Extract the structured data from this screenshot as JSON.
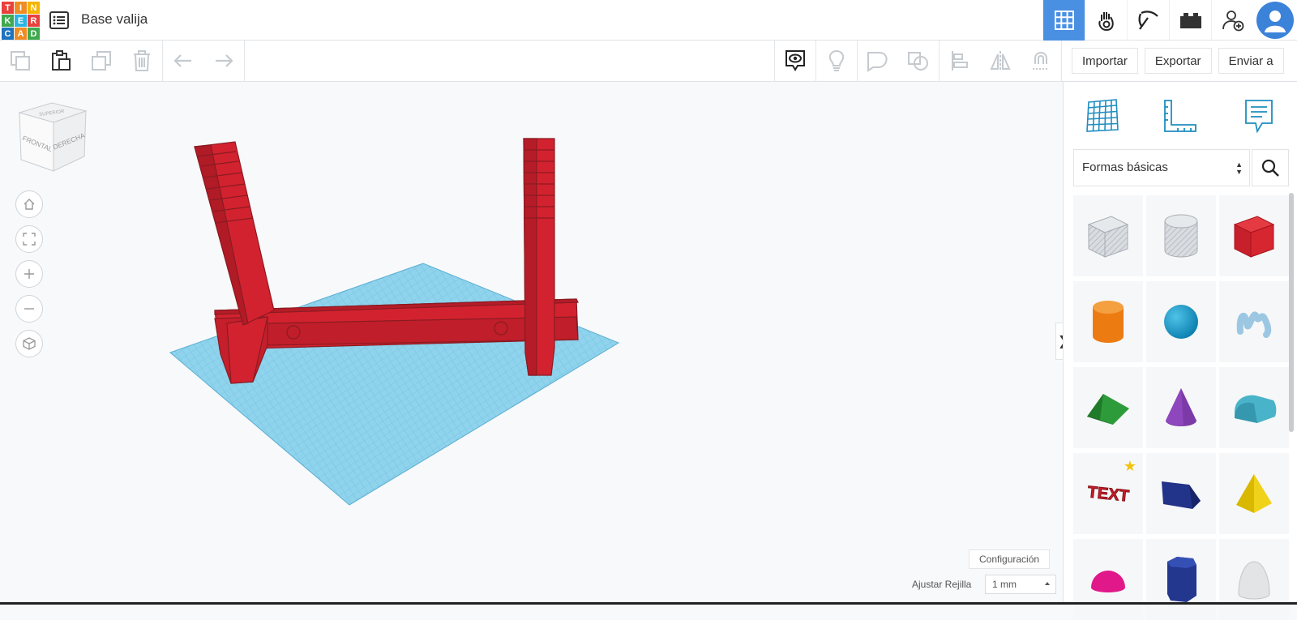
{
  "app": {
    "logo_letters": [
      "T",
      "I",
      "N",
      "K",
      "E",
      "R",
      "C",
      "A",
      "D"
    ],
    "logo_colors": [
      "#e8413c",
      "#f08c25",
      "#f4b400",
      "#3fa94d",
      "#2bb3e2",
      "#e8413c",
      "#1e73be",
      "#f08c25",
      "#3fa94d"
    ],
    "design_title": "Base valija"
  },
  "topbar": {
    "icons": [
      "grid-view-icon",
      "hand-gesture-icon",
      "pickaxe-icon",
      "brick-icon",
      "add-user-icon"
    ],
    "active_color": "#4a90e2"
  },
  "toolbar": {
    "import_label": "Importar",
    "export_label": "Exportar",
    "send_label": "Enviar a"
  },
  "viewcube": {
    "top_label": "SUPERIOR",
    "front_label": "FRONTAL",
    "right_label": "DERECHA"
  },
  "workplane": {
    "config_label": "Configuración",
    "grid_label": "Ajustar Rejilla",
    "grid_value": "1 mm",
    "plane_color": "#8fd3ec",
    "object_color": "#d3222f"
  },
  "panel": {
    "category": "Formas básicas",
    "shapes": [
      "box-hole-shape",
      "cylinder-hole-shape",
      "box-shape",
      "cylinder-shape",
      "sphere-shape",
      "scribble-shape",
      "roof-shape",
      "cone-shape",
      "round-roof-shape",
      "text-shape",
      "wedge-shape",
      "pyramid-shape",
      "half-sphere-shape",
      "polygon-shape",
      "paraboloid-shape"
    ],
    "text_shape_label": "TEXT"
  }
}
